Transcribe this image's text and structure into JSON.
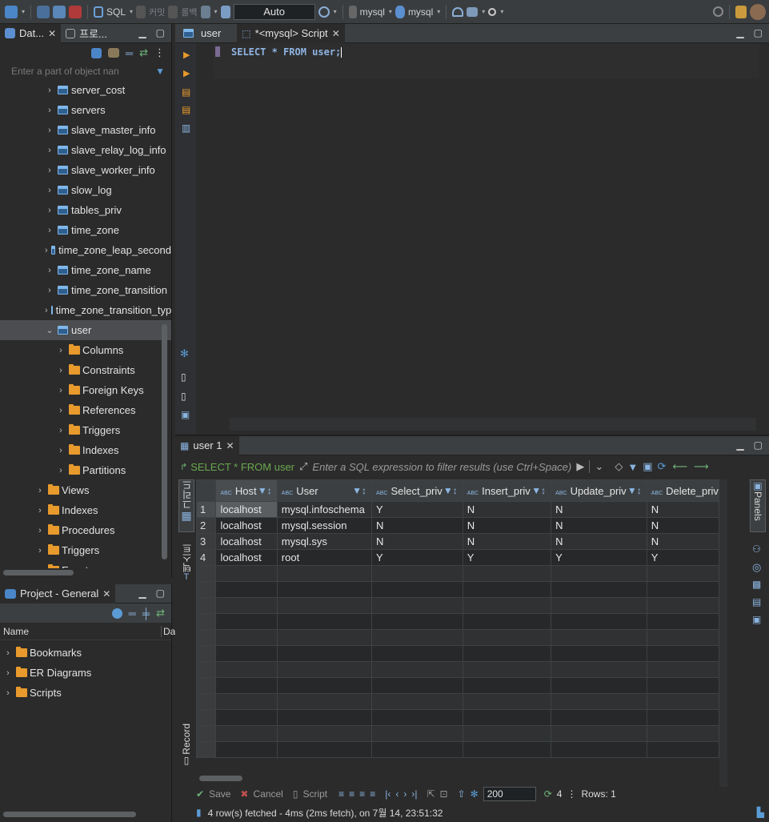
{
  "toolbar": {
    "sql_label": "SQL",
    "commit_label": "커밋",
    "rollback_label": "롤백",
    "tx_mode": "Auto",
    "datasource": "mysql",
    "schema": "mysql"
  },
  "nav": {
    "tab_db": "Dat...",
    "tab_project": "프로...",
    "filter_placeholder": "Enter a part of object nan",
    "tables": [
      "server_cost",
      "servers",
      "slave_master_info",
      "slave_relay_log_info",
      "slave_worker_info",
      "slow_log",
      "tables_priv",
      "time_zone",
      "time_zone_leap_second",
      "time_zone_name",
      "time_zone_transition",
      "time_zone_transition_type"
    ],
    "selected_table": "user",
    "table_children": [
      "Columns",
      "Constraints",
      "Foreign Keys",
      "References",
      "Triggers",
      "Indexes",
      "Partitions"
    ],
    "schema_children": [
      "Views",
      "Indexes",
      "Procedures",
      "Triggers",
      "Events"
    ]
  },
  "project": {
    "title": "Project - General",
    "col_name": "Name",
    "col_da": "Da",
    "items": [
      "Bookmarks",
      "ER Diagrams",
      "Scripts"
    ]
  },
  "editor": {
    "tab_user": "user",
    "tab_script": "*<mysql> Script",
    "sql": "SELECT * FROM user;"
  },
  "results": {
    "tab_label": "user 1",
    "query": "SELECT * FROM user",
    "filter_placeholder": "Enter a SQL expression to filter results (use Ctrl+Space)",
    "side_tab_grid": "그리드",
    "side_tab_text": "텍스트",
    "side_tab_record": "Record",
    "panels_label": "Panels",
    "columns": [
      "Host",
      "User",
      "Select_priv",
      "Insert_priv",
      "Update_priv",
      "Delete_priv"
    ],
    "rows": [
      {
        "n": "1",
        "cells": [
          "localhost",
          "mysql.infoschema",
          "Y",
          "N",
          "N",
          "N"
        ]
      },
      {
        "n": "2",
        "cells": [
          "localhost",
          "mysql.session",
          "N",
          "N",
          "N",
          "N"
        ]
      },
      {
        "n": "3",
        "cells": [
          "localhost",
          "mysql.sys",
          "N",
          "N",
          "N",
          "N"
        ]
      },
      {
        "n": "4",
        "cells": [
          "localhost",
          "root",
          "Y",
          "Y",
          "Y",
          "Y"
        ]
      }
    ],
    "save": "Save",
    "cancel": "Cancel",
    "script": "Script",
    "fetch_size": "200",
    "row_count": "4",
    "rows_label": "Rows: 1",
    "status": "4 row(s) fetched - 4ms (2ms fetch), on 7월 14, 23:51:32"
  }
}
